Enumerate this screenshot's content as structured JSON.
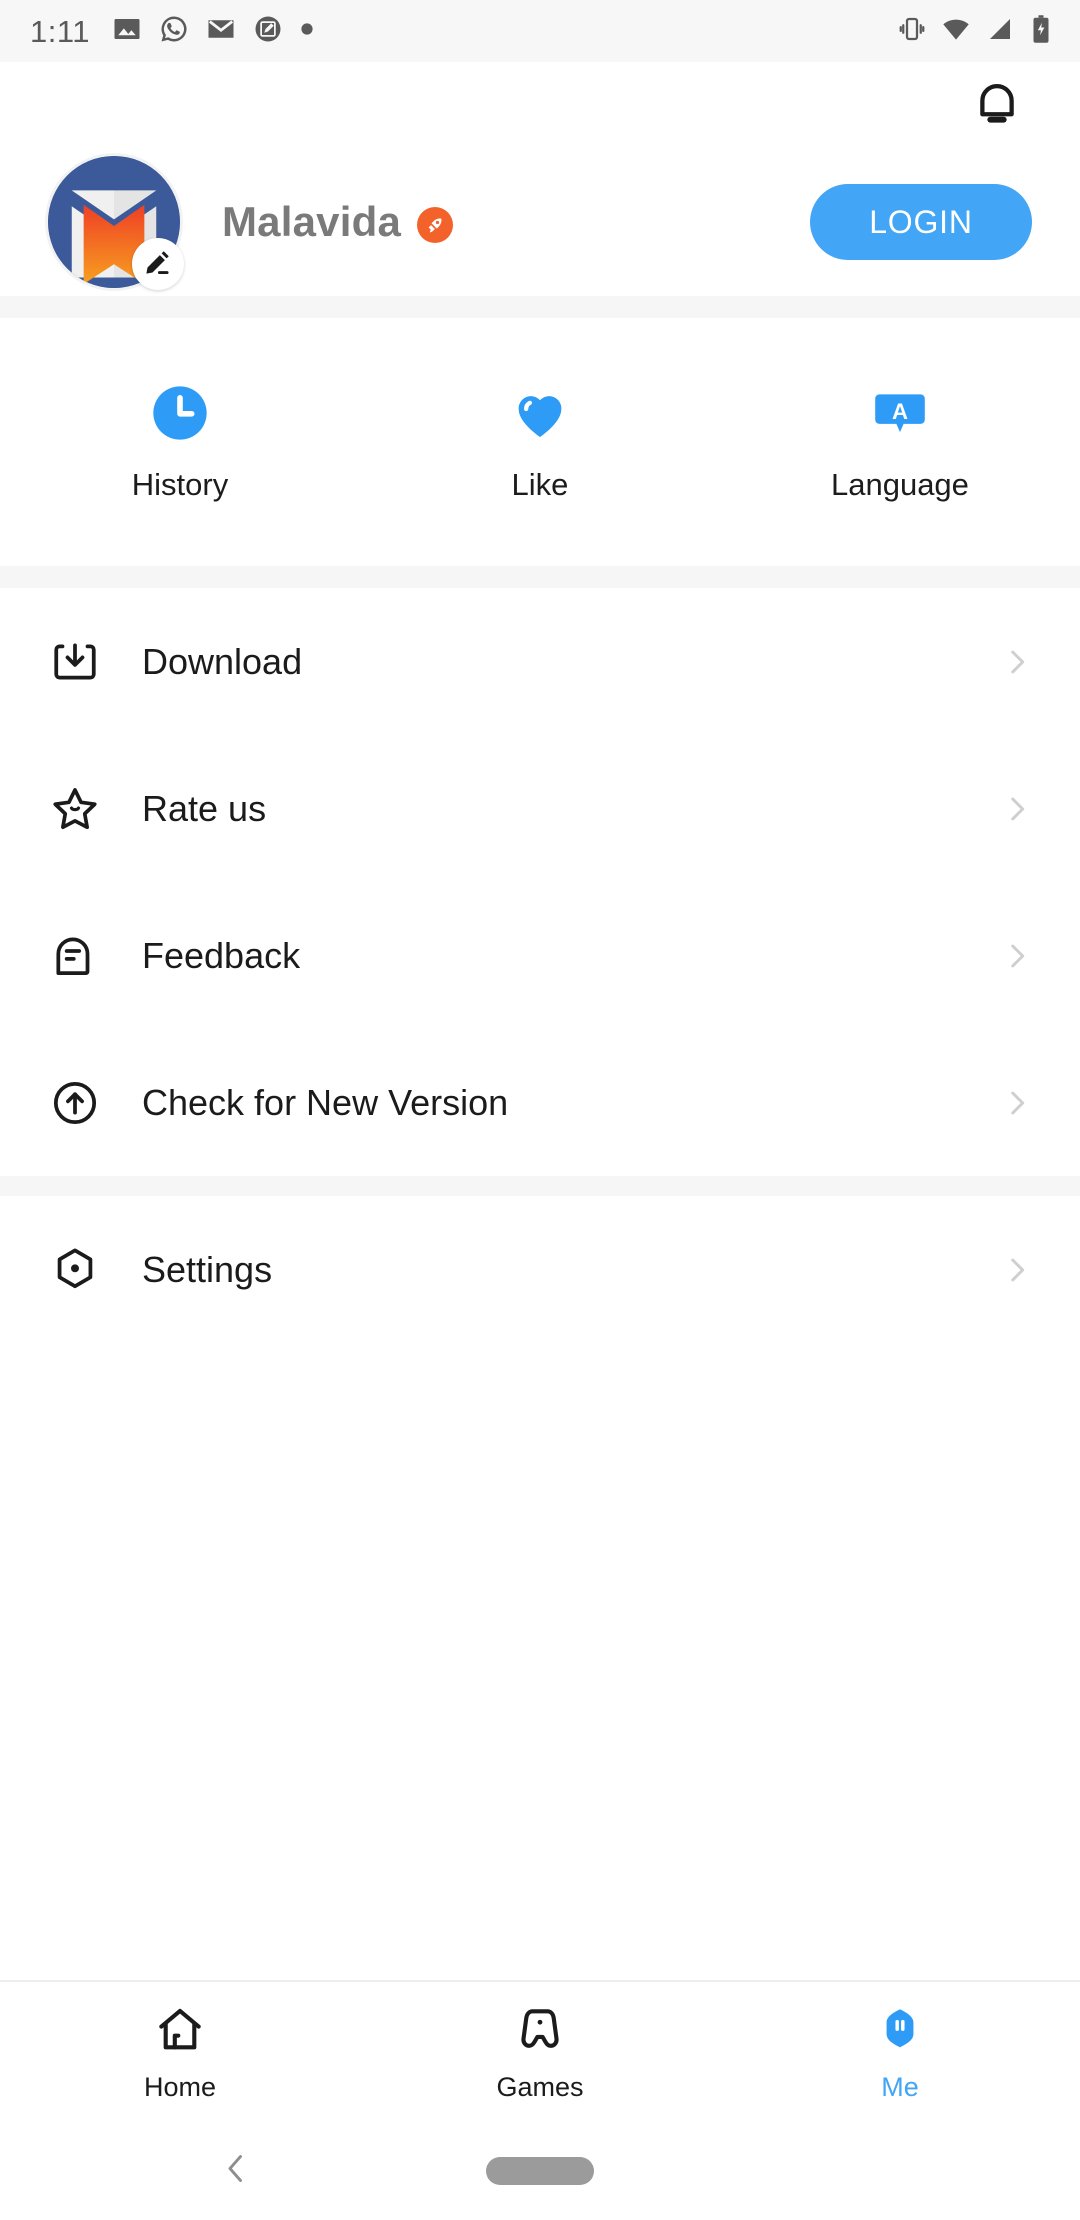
{
  "statusbar": {
    "time": "1:11",
    "left_icons": [
      "photos-icon",
      "whatsapp-icon",
      "gmail-icon",
      "screenshot-markup-icon",
      "dot-indicator-icon"
    ],
    "right_icons": [
      "vibrate-icon",
      "wifi-icon",
      "cellular-signal-icon",
      "battery-charging-icon"
    ]
  },
  "topbar": {
    "notification_icon": "bell-icon"
  },
  "profile": {
    "avatar_alt": "malavida-logo-avatar",
    "edit_icon": "pencil-edit-icon",
    "name": "Malavida",
    "verified_badge_icon": "rocket-icon",
    "login_label": "LOGIN"
  },
  "quick_actions": [
    {
      "id": "history",
      "label": "History",
      "icon": "clock-icon"
    },
    {
      "id": "like",
      "label": "Like",
      "icon": "heart-icon"
    },
    {
      "id": "language",
      "label": "Language",
      "icon": "translate-language-icon"
    }
  ],
  "menu_groups": [
    {
      "items": [
        {
          "id": "download",
          "label": "Download",
          "icon": "download-tray-icon",
          "chevron": "chevron-right-icon"
        },
        {
          "id": "rate-us",
          "label": "Rate us",
          "icon": "star-icon",
          "chevron": "chevron-right-icon"
        },
        {
          "id": "feedback",
          "label": "Feedback",
          "icon": "feedback-chat-icon",
          "chevron": "chevron-right-icon"
        },
        {
          "id": "check-new-version",
          "label": "Check for New Version",
          "icon": "update-arrow-icon",
          "chevron": "chevron-right-icon"
        }
      ]
    },
    {
      "items": [
        {
          "id": "settings",
          "label": "Settings",
          "icon": "settings-hexagon-icon",
          "chevron": "chevron-right-icon"
        }
      ]
    }
  ],
  "bottom_nav": [
    {
      "id": "home",
      "label": "Home",
      "icon": "home-icon",
      "active": false
    },
    {
      "id": "games",
      "label": "Games",
      "icon": "gamepad-icon",
      "active": false
    },
    {
      "id": "me",
      "label": "Me",
      "icon": "me-profile-icon",
      "active": true
    }
  ],
  "system_nav": {
    "back_icon": "back-chevron-icon",
    "home_pill": "home-indicator-pill"
  },
  "colors": {
    "accent_blue": "#42a5f5",
    "brand_orange": "#f2622a",
    "brand_navy": "#3c5a9a",
    "divider_gray": "#f6f6f6",
    "text_primary": "#1b1b1b",
    "text_muted": "#7a7a7a",
    "chevron_gray": "#cfcfcf"
  }
}
